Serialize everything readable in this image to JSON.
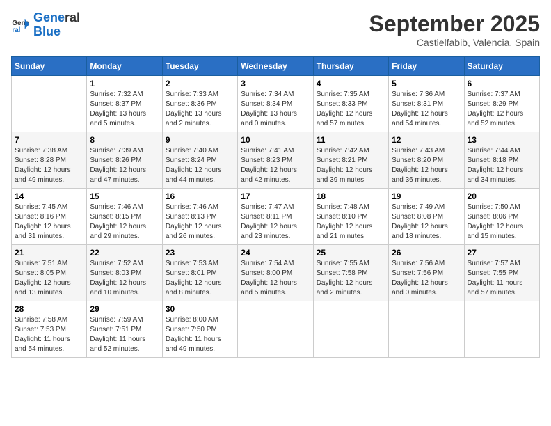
{
  "header": {
    "logo_line1": "General",
    "logo_line2": "Blue",
    "title": "September 2025",
    "subtitle": "Castielfabib, Valencia, Spain"
  },
  "days_of_week": [
    "Sunday",
    "Monday",
    "Tuesday",
    "Wednesday",
    "Thursday",
    "Friday",
    "Saturday"
  ],
  "weeks": [
    [
      {
        "day": "",
        "info": ""
      },
      {
        "day": "1",
        "info": "Sunrise: 7:32 AM\nSunset: 8:37 PM\nDaylight: 13 hours\nand 5 minutes."
      },
      {
        "day": "2",
        "info": "Sunrise: 7:33 AM\nSunset: 8:36 PM\nDaylight: 13 hours\nand 2 minutes."
      },
      {
        "day": "3",
        "info": "Sunrise: 7:34 AM\nSunset: 8:34 PM\nDaylight: 13 hours\nand 0 minutes."
      },
      {
        "day": "4",
        "info": "Sunrise: 7:35 AM\nSunset: 8:33 PM\nDaylight: 12 hours\nand 57 minutes."
      },
      {
        "day": "5",
        "info": "Sunrise: 7:36 AM\nSunset: 8:31 PM\nDaylight: 12 hours\nand 54 minutes."
      },
      {
        "day": "6",
        "info": "Sunrise: 7:37 AM\nSunset: 8:29 PM\nDaylight: 12 hours\nand 52 minutes."
      }
    ],
    [
      {
        "day": "7",
        "info": "Sunrise: 7:38 AM\nSunset: 8:28 PM\nDaylight: 12 hours\nand 49 minutes."
      },
      {
        "day": "8",
        "info": "Sunrise: 7:39 AM\nSunset: 8:26 PM\nDaylight: 12 hours\nand 47 minutes."
      },
      {
        "day": "9",
        "info": "Sunrise: 7:40 AM\nSunset: 8:24 PM\nDaylight: 12 hours\nand 44 minutes."
      },
      {
        "day": "10",
        "info": "Sunrise: 7:41 AM\nSunset: 8:23 PM\nDaylight: 12 hours\nand 42 minutes."
      },
      {
        "day": "11",
        "info": "Sunrise: 7:42 AM\nSunset: 8:21 PM\nDaylight: 12 hours\nand 39 minutes."
      },
      {
        "day": "12",
        "info": "Sunrise: 7:43 AM\nSunset: 8:20 PM\nDaylight: 12 hours\nand 36 minutes."
      },
      {
        "day": "13",
        "info": "Sunrise: 7:44 AM\nSunset: 8:18 PM\nDaylight: 12 hours\nand 34 minutes."
      }
    ],
    [
      {
        "day": "14",
        "info": "Sunrise: 7:45 AM\nSunset: 8:16 PM\nDaylight: 12 hours\nand 31 minutes."
      },
      {
        "day": "15",
        "info": "Sunrise: 7:46 AM\nSunset: 8:15 PM\nDaylight: 12 hours\nand 29 minutes."
      },
      {
        "day": "16",
        "info": "Sunrise: 7:46 AM\nSunset: 8:13 PM\nDaylight: 12 hours\nand 26 minutes."
      },
      {
        "day": "17",
        "info": "Sunrise: 7:47 AM\nSunset: 8:11 PM\nDaylight: 12 hours\nand 23 minutes."
      },
      {
        "day": "18",
        "info": "Sunrise: 7:48 AM\nSunset: 8:10 PM\nDaylight: 12 hours\nand 21 minutes."
      },
      {
        "day": "19",
        "info": "Sunrise: 7:49 AM\nSunset: 8:08 PM\nDaylight: 12 hours\nand 18 minutes."
      },
      {
        "day": "20",
        "info": "Sunrise: 7:50 AM\nSunset: 8:06 PM\nDaylight: 12 hours\nand 15 minutes."
      }
    ],
    [
      {
        "day": "21",
        "info": "Sunrise: 7:51 AM\nSunset: 8:05 PM\nDaylight: 12 hours\nand 13 minutes."
      },
      {
        "day": "22",
        "info": "Sunrise: 7:52 AM\nSunset: 8:03 PM\nDaylight: 12 hours\nand 10 minutes."
      },
      {
        "day": "23",
        "info": "Sunrise: 7:53 AM\nSunset: 8:01 PM\nDaylight: 12 hours\nand 8 minutes."
      },
      {
        "day": "24",
        "info": "Sunrise: 7:54 AM\nSunset: 8:00 PM\nDaylight: 12 hours\nand 5 minutes."
      },
      {
        "day": "25",
        "info": "Sunrise: 7:55 AM\nSunset: 7:58 PM\nDaylight: 12 hours\nand 2 minutes."
      },
      {
        "day": "26",
        "info": "Sunrise: 7:56 AM\nSunset: 7:56 PM\nDaylight: 12 hours\nand 0 minutes."
      },
      {
        "day": "27",
        "info": "Sunrise: 7:57 AM\nSunset: 7:55 PM\nDaylight: 11 hours\nand 57 minutes."
      }
    ],
    [
      {
        "day": "28",
        "info": "Sunrise: 7:58 AM\nSunset: 7:53 PM\nDaylight: 11 hours\nand 54 minutes."
      },
      {
        "day": "29",
        "info": "Sunrise: 7:59 AM\nSunset: 7:51 PM\nDaylight: 11 hours\nand 52 minutes."
      },
      {
        "day": "30",
        "info": "Sunrise: 8:00 AM\nSunset: 7:50 PM\nDaylight: 11 hours\nand 49 minutes."
      },
      {
        "day": "",
        "info": ""
      },
      {
        "day": "",
        "info": ""
      },
      {
        "day": "",
        "info": ""
      },
      {
        "day": "",
        "info": ""
      }
    ]
  ]
}
